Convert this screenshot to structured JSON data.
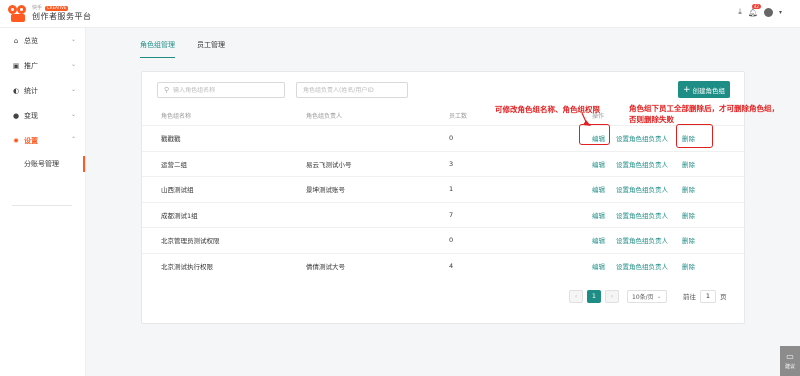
{
  "header": {
    "logo_small": "快手",
    "logo_tag": "CREATIVE",
    "logo_title": "创作者服务平台",
    "notification_count": "42"
  },
  "sidebar": {
    "items": [
      {
        "label": "总览",
        "icon": "home-icon"
      },
      {
        "label": "推广",
        "icon": "promote-icon"
      },
      {
        "label": "统计",
        "icon": "stats-icon"
      },
      {
        "label": "变现",
        "icon": "monetize-icon"
      },
      {
        "label": "设置",
        "icon": "settings-icon"
      }
    ],
    "sub_item": "分账号管理"
  },
  "tabs": [
    "角色组管理",
    "员工管理"
  ],
  "search": {
    "role_placeholder": "输入角色组名称",
    "owner_placeholder": "角色组负责人(姓名/用户ID"
  },
  "create_button": "创建角色组",
  "table": {
    "headers": [
      "角色组名称",
      "角色组负责人",
      "员工数",
      "操作"
    ],
    "rows": [
      {
        "name": "戳戳戳",
        "owner": "",
        "count": "0"
      },
      {
        "name": "运营二组",
        "owner": "易云飞测试小号",
        "count": "3"
      },
      {
        "name": "山西测试组",
        "owner": "景坤测试账号",
        "count": "1"
      },
      {
        "name": "成都测试1组",
        "owner": "",
        "count": "7"
      },
      {
        "name": "北京管理员测试权限",
        "owner": "",
        "count": "0"
      },
      {
        "name": "北京测试执行权限",
        "owner": "倩倩测试大号",
        "count": "4"
      }
    ],
    "actions": {
      "edit": "编辑",
      "set_owner": "设置角色组负责人",
      "delete": "删除"
    }
  },
  "pagination": {
    "current_page": "1",
    "page_size": "10条/页",
    "goto_label": "前往",
    "goto_value": "1",
    "page_unit": "页"
  },
  "annotations": {
    "edit_note": "可修改角色组名称、角色组权限",
    "delete_note_line1": "角色组下员工全部删除后，才可删除角色组，",
    "delete_note_line2": "否则删除失败"
  },
  "help": {
    "label": "建议"
  }
}
